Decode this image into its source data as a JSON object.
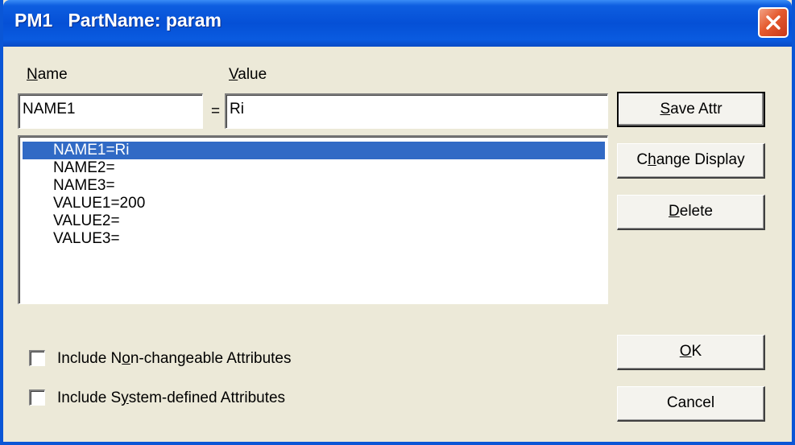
{
  "window": {
    "title": "PM1   PartName: param"
  },
  "fields": {
    "name_label_mnemonic": "N",
    "name_label_rest": "ame",
    "value_label_mnemonic": "V",
    "value_label_rest": "alue",
    "name_value": "NAME1",
    "equals": "=",
    "value_value": "Ri"
  },
  "list": {
    "items": [
      {
        "label": "NAME1=Ri",
        "selected": true
      },
      {
        "label": "NAME2=",
        "selected": false
      },
      {
        "label": "NAME3=",
        "selected": false
      },
      {
        "label": "VALUE1=200",
        "selected": false
      },
      {
        "label": "VALUE2=",
        "selected": false
      },
      {
        "label": "VALUE3=",
        "selected": false
      }
    ]
  },
  "buttons": {
    "save_attr_mnemonic": "S",
    "save_attr_rest": "ave Attr",
    "change_display_pre": "C",
    "change_display_mnemonic": "h",
    "change_display_rest": "ange Display",
    "delete_mnemonic": "D",
    "delete_rest": "elete",
    "ok_mnemonic": "O",
    "ok_rest": "K",
    "cancel": "Cancel"
  },
  "options": {
    "non_changeable_pre": "Include N",
    "non_changeable_mnemonic": "o",
    "non_changeable_rest": "n-changeable Attributes",
    "non_changeable_checked": false,
    "system_defined_pre": "Include S",
    "system_defined_mnemonic": "y",
    "system_defined_rest": "stem-defined Attributes",
    "system_defined_checked": false
  },
  "colors": {
    "titlebar": "#0550D6",
    "selection": "#316AC5",
    "dialog_bg": "#ECE9D8",
    "close_button": "#E55A2E"
  }
}
